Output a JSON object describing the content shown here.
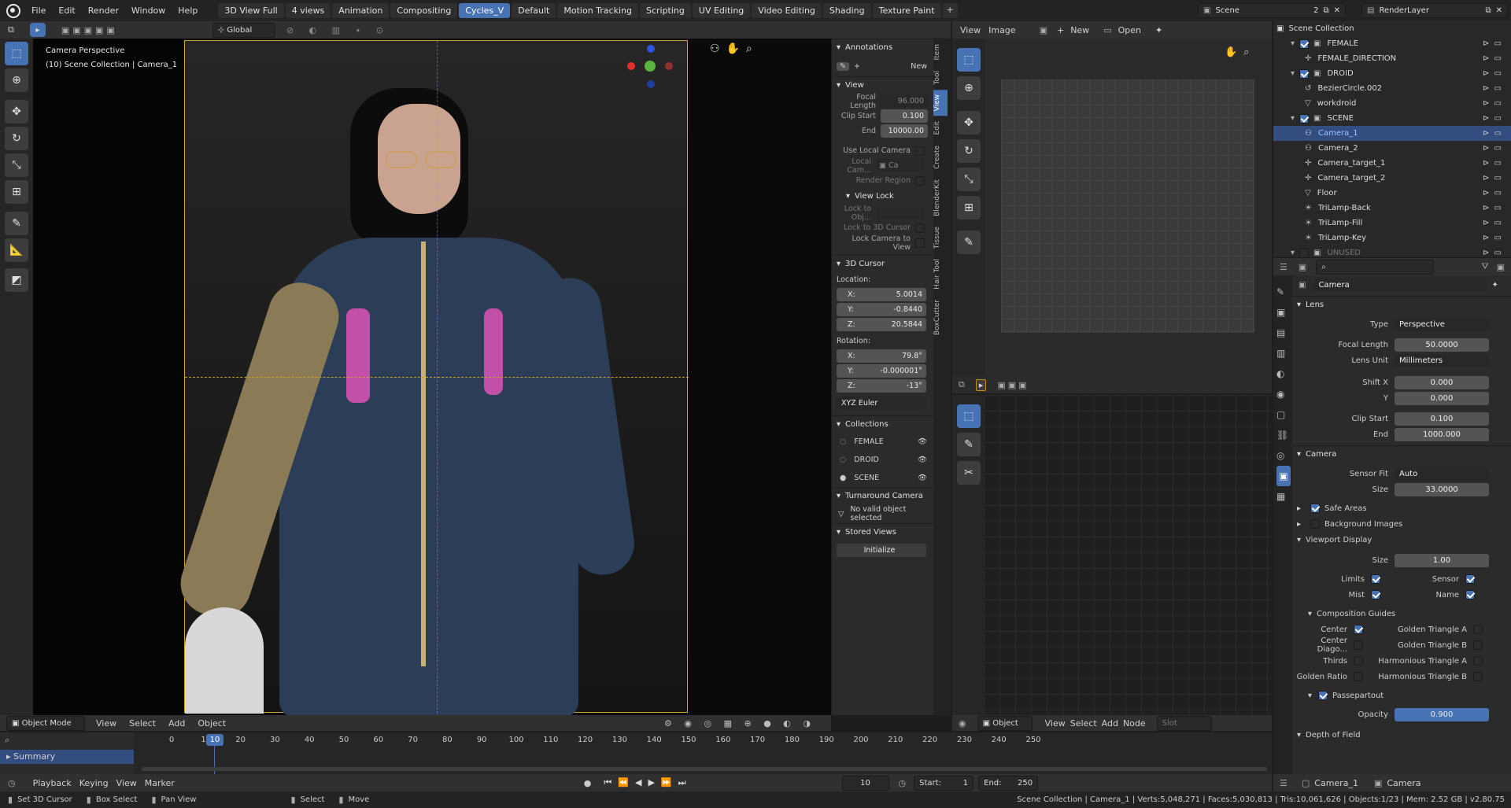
{
  "menubar": {
    "items": [
      "File",
      "Edit",
      "Render",
      "Window",
      "Help"
    ],
    "workspaces": [
      "3D View Full",
      "4 views",
      "Animation",
      "Compositing",
      "Cycles_V",
      "Default",
      "Motion Tracking",
      "Scripting",
      "UV Editing",
      "Video Editing",
      "Shading",
      "Texture Paint"
    ],
    "active_workspace": "Cycles_V",
    "scene_label": "Scene",
    "scene_users": "2",
    "render_layer": "RenderLayer"
  },
  "viewport": {
    "transform_orientation": "Global",
    "overlay_title": "Camera Perspective",
    "overlay_sub": "(10) Scene Collection | Camera_1",
    "mode": "Object Mode",
    "menus": [
      "View",
      "Select",
      "Add",
      "Object"
    ]
  },
  "npanel": {
    "annotations": "Annotations",
    "new": "New",
    "view": "View",
    "focal_length_label": "Focal Length",
    "focal_length": "96.000",
    "clip_start_label": "Clip Start",
    "clip_start": "0.100",
    "end_label": "End",
    "end": "10000.00",
    "use_local_camera": "Use Local Camera",
    "local_cam_label": "Local Cam...",
    "local_cam_value": "Ca",
    "render_region": "Render Region",
    "view_lock": "View Lock",
    "lock_to_obj": "Lock to Obj...",
    "lock_to_cursor": "Lock to 3D Cursor",
    "lock_camera": "Lock Camera to View",
    "cursor": "3D Cursor",
    "location_label": "Location:",
    "loc": [
      {
        "axis": "X:",
        "value": "5.0014"
      },
      {
        "axis": "Y:",
        "value": "-0.8440"
      },
      {
        "axis": "Z:",
        "value": "20.5844"
      }
    ],
    "rotation_label": "Rotation:",
    "rot": [
      {
        "axis": "X:",
        "value": "79.8°"
      },
      {
        "axis": "Y:",
        "value": "-0.000001°"
      },
      {
        "axis": "Z:",
        "value": "-13°"
      }
    ],
    "rotation_mode": "XYZ Euler",
    "collections": "Collections",
    "collection_items": [
      "FEMALE",
      "DROID",
      "SCENE"
    ],
    "turnaround": "Turnaround Camera",
    "no_valid": "No valid object selected",
    "stored_views": "Stored Views",
    "initialize": "Initialize",
    "tabs": [
      "Item",
      "Tool",
      "View",
      "Edit",
      "Create",
      "BlenderKit",
      "Tissue",
      "Hair Tool",
      "BoxCutter"
    ],
    "active_tab": "View"
  },
  "image_editor": {
    "menus": [
      "View",
      "Image"
    ],
    "new": "New",
    "open": "Open"
  },
  "node_editor": {
    "object_label": "Object",
    "menus": [
      "View",
      "Select",
      "Add",
      "Node"
    ],
    "slot": "Slot"
  },
  "outliner": {
    "root": "Scene Collection",
    "items": [
      {
        "name": "FEMALE",
        "depth": 1,
        "type": "collection"
      },
      {
        "name": "FEMALE_DIRECTION",
        "depth": 2,
        "type": "empty"
      },
      {
        "name": "DROID",
        "depth": 1,
        "type": "collection"
      },
      {
        "name": "BezierCircle.002",
        "depth": 2,
        "type": "curve"
      },
      {
        "name": "workdroid",
        "depth": 2,
        "type": "mesh"
      },
      {
        "name": "SCENE",
        "depth": 1,
        "type": "collection"
      },
      {
        "name": "Camera_1",
        "depth": 2,
        "type": "camera",
        "active": true
      },
      {
        "name": "Camera_2",
        "depth": 2,
        "type": "camera"
      },
      {
        "name": "Camera_target_1",
        "depth": 2,
        "type": "empty"
      },
      {
        "name": "Camera_target_2",
        "depth": 2,
        "type": "empty"
      },
      {
        "name": "Floor",
        "depth": 2,
        "type": "mesh"
      },
      {
        "name": "TriLamp-Back",
        "depth": 2,
        "type": "light"
      },
      {
        "name": "TriLamp-Fill",
        "depth": 2,
        "type": "light"
      },
      {
        "name": "TriLamp-Key",
        "depth": 2,
        "type": "light"
      },
      {
        "name": "UNUSED",
        "depth": 1,
        "type": "collection",
        "dim": true
      }
    ]
  },
  "properties": {
    "object_name": "Camera",
    "lens": "Lens",
    "type_label": "Type",
    "type_value": "Perspective",
    "focal_length_label": "Focal Length",
    "focal_length": "50.0000",
    "lens_unit_label": "Lens Unit",
    "lens_unit": "Millimeters",
    "shift_x_label": "Shift X",
    "shift_x": "0.000",
    "shift_y_label": "Y",
    "shift_y": "0.000",
    "clip_start_label": "Clip Start",
    "clip_start": "0.100",
    "clip_end_label": "End",
    "clip_end": "1000.000",
    "camera": "Camera",
    "sensor_fit_label": "Sensor Fit",
    "sensor_fit": "Auto",
    "size_label": "Size",
    "size": "33.0000",
    "safe_areas": "Safe Areas",
    "background_images": "Background Images",
    "viewport_display": "Viewport Display",
    "vd_size_label": "Size",
    "vd_size": "1.00",
    "limits": "Limits",
    "sensor": "Sensor",
    "mist": "Mist",
    "name": "Name",
    "composition_guides": "Composition Guides",
    "guides_left": [
      {
        "label": "Center",
        "on": true
      },
      {
        "label": "Center Diago...",
        "on": false
      },
      {
        "label": "Thirds",
        "on": false
      },
      {
        "label": "Golden Ratio",
        "on": false
      }
    ],
    "guides_right": [
      {
        "label": "Golden Triangle A",
        "on": false
      },
      {
        "label": "Golden Triangle B",
        "on": false
      },
      {
        "label": "Harmonious Triangle A",
        "on": false
      },
      {
        "label": "Harmonious Triangle B",
        "on": false
      }
    ],
    "passepartout": "Passepartout",
    "opacity_label": "Opacity",
    "opacity": "0.900",
    "depth_of_field": "Depth of Field",
    "footer_obj": "Camera_1",
    "footer_data": "Camera"
  },
  "timeline": {
    "current_frame_badge": "10",
    "ticks": [
      "0",
      "10",
      "20",
      "30",
      "40",
      "50",
      "60",
      "70",
      "80",
      "90",
      "100",
      "110",
      "120",
      "130",
      "140",
      "150",
      "160",
      "170",
      "180",
      "190",
      "200",
      "210",
      "220",
      "230",
      "240",
      "250"
    ],
    "summary": "Summary",
    "menus": [
      "Playback",
      "Keying",
      "View",
      "Marker"
    ],
    "frame": "10",
    "start_label": "Start:",
    "start": "1",
    "end_label": "End:",
    "end": "250"
  },
  "statusbar": {
    "left": [
      "Set 3D Cursor",
      "Box Select",
      "Pan View",
      "Select",
      "Move"
    ],
    "right": "Scene Collection | Camera_1 | Verts:5,048,271 | Faces:5,030,813 | Tris:10,061,626 | Objects:1/23 | Mem: 2.52 GB | v2.80.75"
  }
}
